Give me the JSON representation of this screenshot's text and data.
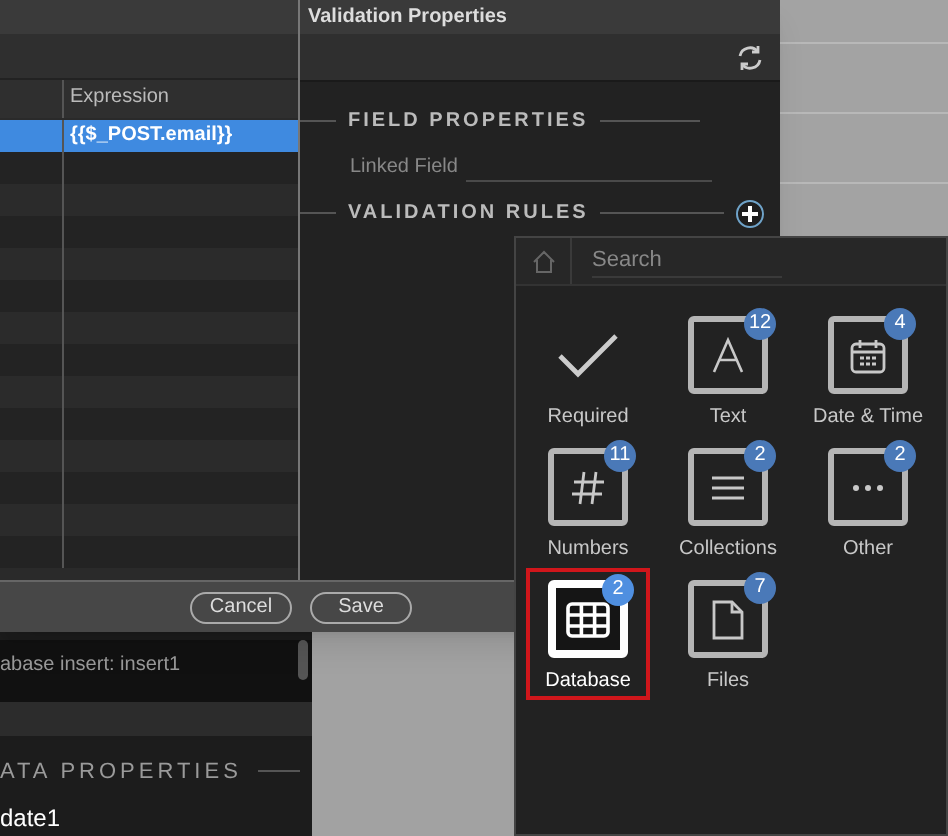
{
  "dialog": {
    "table": {
      "columns": [
        "Expression"
      ],
      "rows": [
        {
          "expression": "{{$_POST.email}}",
          "selected": true
        }
      ]
    },
    "validation_properties": {
      "title": "Validation Properties",
      "sections": [
        {
          "heading": "FIELD PROPERTIES",
          "field_label": "Linked Field"
        },
        {
          "heading": "VALIDATION RULES"
        }
      ]
    },
    "buttons": [
      "Cancel",
      "Save"
    ]
  },
  "background_panel": {
    "list_item": "abase insert: insert1",
    "section_heading": "ATA PROPERTIES",
    "name_value": "date1"
  },
  "picker": {
    "search": {
      "placeholder": "Search"
    },
    "items": [
      {
        "kind": "check",
        "label": "Required",
        "selected": false
      },
      {
        "kind": "text",
        "label": "Text",
        "badge": "12",
        "selected": false
      },
      {
        "kind": "calendar",
        "label": "Date & Time",
        "badge": "4",
        "selected": false
      },
      {
        "kind": "hash",
        "label": "Numbers",
        "badge": "11",
        "selected": false
      },
      {
        "kind": "list",
        "label": "Collections",
        "badge": "2",
        "selected": false
      },
      {
        "kind": "dots",
        "label": "Other",
        "badge": "2",
        "selected": false
      },
      {
        "kind": "table",
        "label": "Database",
        "badge": "2",
        "selected": true
      },
      {
        "kind": "file",
        "label": "Files",
        "badge": "7",
        "selected": false
      }
    ]
  }
}
